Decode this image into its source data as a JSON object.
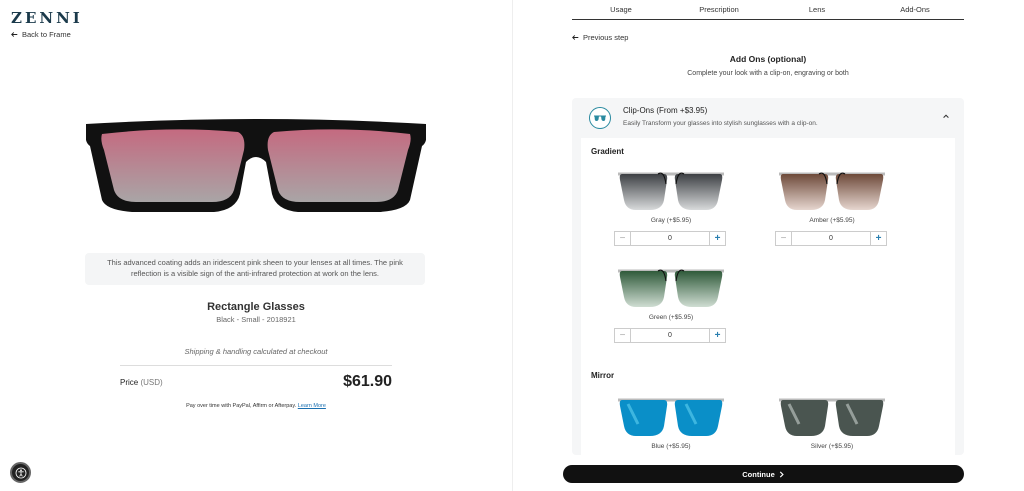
{
  "brand": {
    "logo": "ZENNI"
  },
  "nav": {
    "back_label": "Back to Frame"
  },
  "coating_note": "This advanced coating adds an iridescent pink sheen to your lenses at all times. The pink reflection is a visible sign of the anti-infrared protection at work on the lens.",
  "product": {
    "title": "Rectangle Glasses",
    "subtitle": "Black - Small - 2018921",
    "shipping": "Shipping & handling calculated at checkout",
    "price_label": "Price",
    "price_unit": "(USD)",
    "price": "$61.90",
    "payover_text": "Pay over time with PayPal, Affirm or Afterpay.",
    "learn_more": "Learn More"
  },
  "steps": [
    "Usage",
    "Prescription",
    "Lens",
    "Add-Ons"
  ],
  "right": {
    "prev_label": "Previous step",
    "title": "Add Ons (optional)",
    "subtitle": "Complete your look with a clip-on, engraving or both"
  },
  "clipons": {
    "title": "Clip-Ons (From +$3.95)",
    "description": "Easily Transform your glasses into stylish sunglasses with a clip-on.",
    "groups": [
      {
        "name": "Gradient",
        "options": [
          {
            "label": "Gray (+$5.95)",
            "qty": "0",
            "color": "#3d4044"
          },
          {
            "label": "Amber (+$5.95)",
            "qty": "0",
            "color": "#6e4a3a"
          },
          {
            "label": "Green (+$5.95)",
            "qty": "0",
            "color": "#2f5a3a"
          }
        ]
      },
      {
        "name": "Mirror",
        "options": [
          {
            "label": "Blue (+$5.95)",
            "color": "#0a8fc8"
          },
          {
            "label": "Silver (+$5.95)",
            "color": "#4a5550"
          }
        ]
      }
    ]
  },
  "continue_label": "Continue",
  "colors": {
    "accent": "#2a7fb0",
    "lens_tint": "#c46a80",
    "frame": "#111111"
  }
}
